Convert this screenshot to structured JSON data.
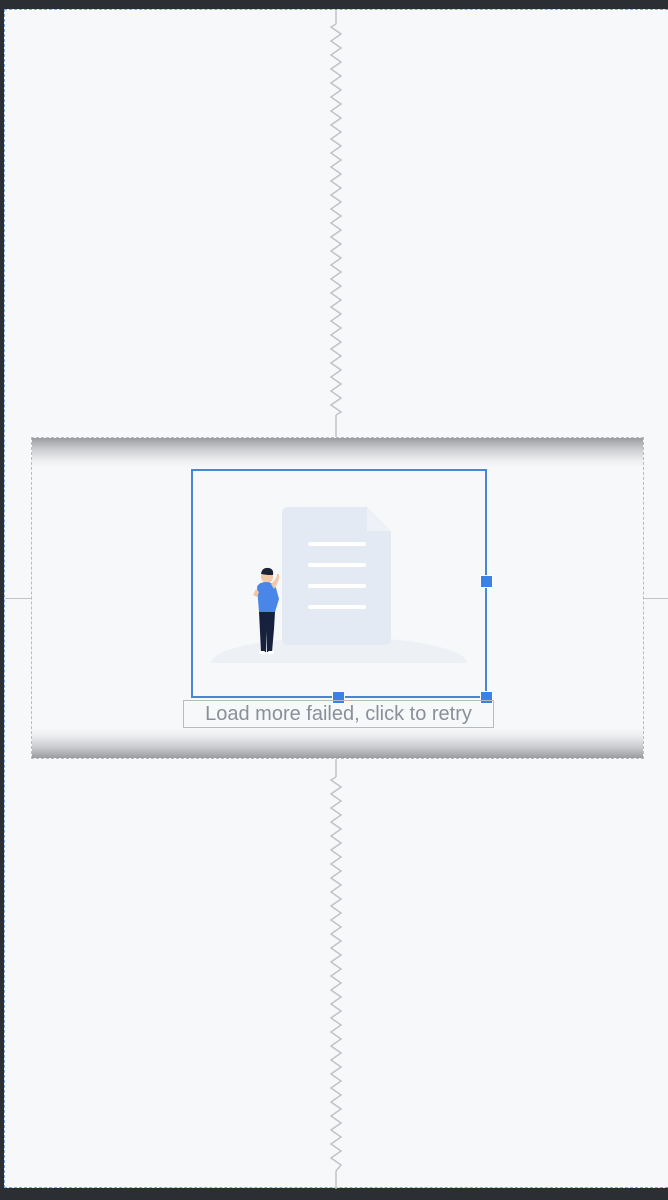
{
  "colors": {
    "background": "#2b2e33",
    "canvas": "#f6f8fa",
    "selection": "#4a86d6",
    "handle": "#3b82e6",
    "text": "#8a9099",
    "guide": "#c0c3c8"
  },
  "load_more": {
    "retry_text": "Load more failed, click to retry",
    "illustration_icon": "empty-document-illustration-icon"
  }
}
